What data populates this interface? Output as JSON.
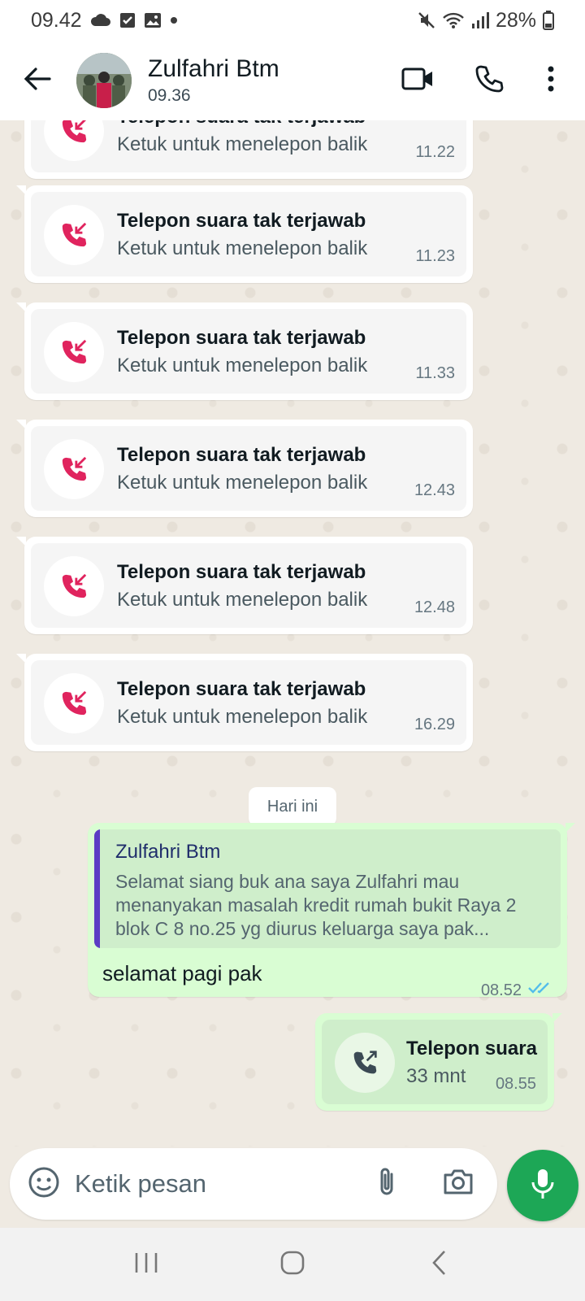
{
  "status_bar": {
    "time": "09.42",
    "battery": "28%",
    "icons": [
      "cloud-icon",
      "checkbox-icon",
      "image-icon",
      "dot-icon",
      "mute-icon",
      "wifi-icon",
      "signal-icon",
      "battery-icon"
    ]
  },
  "header": {
    "contact_name": "Zulfahri Btm",
    "last_seen": "09.36",
    "icons": [
      "back-arrow-icon",
      "video-call-icon",
      "phone-icon",
      "more-vert-icon"
    ]
  },
  "calls": [
    {
      "title": "Telepon suara tak terjawab",
      "subtitle": "Ketuk untuk menelepon balik",
      "time": "11.22"
    },
    {
      "title": "Telepon suara tak terjawab",
      "subtitle": "Ketuk untuk menelepon balik",
      "time": "11.23"
    },
    {
      "title": "Telepon suara tak terjawab",
      "subtitle": "Ketuk untuk menelepon balik",
      "time": "11.33"
    },
    {
      "title": "Telepon suara tak terjawab",
      "subtitle": "Ketuk untuk menelepon balik",
      "time": "12.43"
    },
    {
      "title": "Telepon suara tak terjawab",
      "subtitle": "Ketuk untuk menelepon balik",
      "time": "12.48"
    },
    {
      "title": "Telepon suara tak terjawab",
      "subtitle": "Ketuk untuk menelepon balik",
      "time": "16.29"
    }
  ],
  "date_chip": "Hari ini",
  "reply_message": {
    "quoted_name": "Zulfahri Btm",
    "quoted_text": "Selamat siang buk ana saya Zulfahri mau menanyakan masalah kredit rumah bukit Raya 2 blok C 8 no.25 yg diurus keluarga saya pak...",
    "text": "selamat pagi pak",
    "time": "08.52"
  },
  "outgoing_call": {
    "title": "Telepon suara",
    "duration": "33 mnt",
    "time": "08.55"
  },
  "composer": {
    "placeholder": "Ketik pesan"
  },
  "colors": {
    "missed_call": "#e0245e",
    "accent_green": "#1da756",
    "read_ticks": "#53bdeb",
    "out_bubble": "#d9fdd3",
    "quote_bar": "#5b3cc4"
  }
}
